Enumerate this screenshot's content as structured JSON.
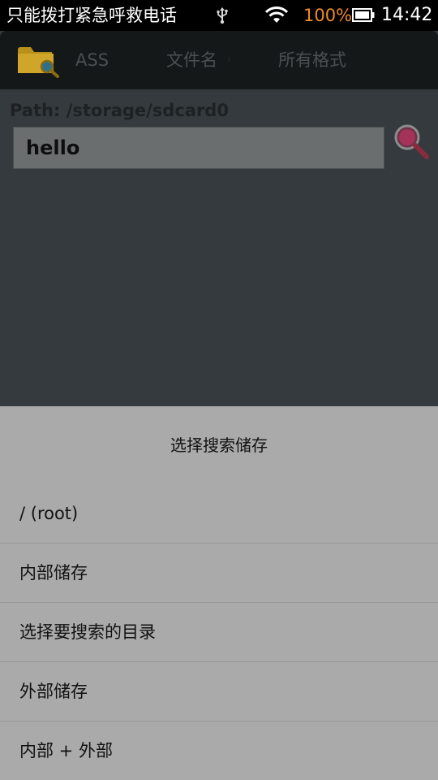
{
  "status_bar": {
    "carrier_text": "只能拨打紧急呼救电话",
    "battery_text": "100%",
    "time": "14:42",
    "battery_color": "#f08a24",
    "icons": [
      "usb-icon",
      "wifi-icon",
      "battery-icon"
    ]
  },
  "toolbar": {
    "logo": "folder-search-icon",
    "tabs": [
      {
        "label": "ASS"
      },
      {
        "label": "文件名（"
      },
      {
        "label": "所有格式"
      }
    ]
  },
  "search": {
    "path_label": "Path: /storage/sdcard0",
    "query": "hello",
    "icon": "magnifier-icon"
  },
  "dialog": {
    "title": "选择搜索储存",
    "options": [
      {
        "label": "/ (root)"
      },
      {
        "label": "内部储存"
      },
      {
        "label": "选择要搜索的目录"
      },
      {
        "label": "外部储存"
      },
      {
        "label": "内部 + 外部"
      }
    ]
  }
}
